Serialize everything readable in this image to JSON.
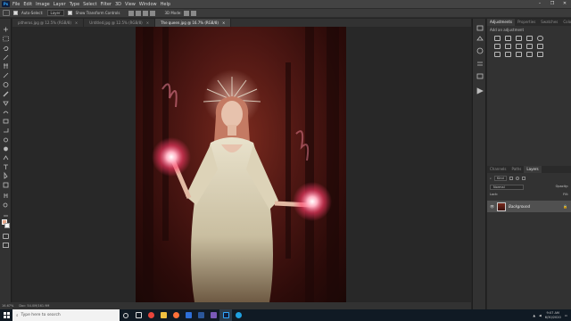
{
  "menubar": {
    "app_badge": "Ps",
    "items": [
      "File",
      "Edit",
      "Image",
      "Layer",
      "Type",
      "Select",
      "Filter",
      "3D",
      "View",
      "Window",
      "Help"
    ]
  },
  "options": {
    "auto_select_label": "Auto-Select:",
    "layer_value": "Layer",
    "transform_label": "Show Transform Controls",
    "mode_label": "3D Mode:"
  },
  "tabs": [
    {
      "label": "pitheros.jpg @ 12.5% (RGB/8)",
      "active": false
    },
    {
      "label": "Untitled.jpg @ 12.5% (RGB/8)",
      "active": false
    },
    {
      "label": "The queen.jpg @ 16.7% (RGB/8)",
      "active": true
    }
  ],
  "tab_close_glyph": "×",
  "status": {
    "zoom": "16.67%",
    "doc": "Doc: 54.0M/161.9M"
  },
  "adjustments": {
    "tabs": [
      "Adjustments",
      "Properties",
      "Swatches",
      "Color"
    ],
    "add_label": "Add an adjustment"
  },
  "layers_panel": {
    "tabs": [
      "Channels",
      "Paths",
      "Layers"
    ],
    "kind_label": "Kind",
    "mode_value": "Normal",
    "opacity_label": "Opacity:",
    "lock_label": "Lock:",
    "fill_label": "Fill:",
    "layer_name": "Background"
  },
  "taskbar": {
    "search_placeholder": "Type here to search",
    "time": "9:07 AM",
    "date": "6/30/2020"
  },
  "colors": {
    "menubar": "#434343",
    "panel": "#323232",
    "canvas_bg": "#282828",
    "accent": "#31a8ff",
    "glow": "#ff5a78"
  }
}
